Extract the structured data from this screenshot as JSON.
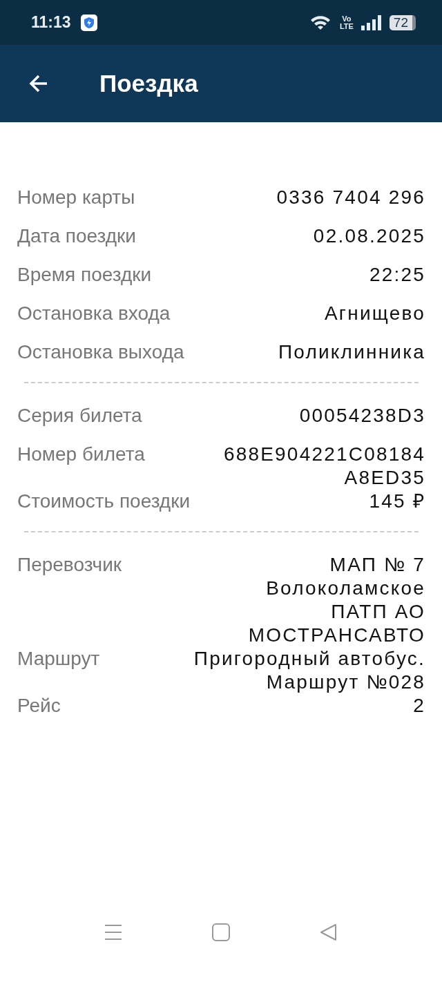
{
  "status_bar": {
    "time": "11:13",
    "network": "Vo\nLTE",
    "battery": "72"
  },
  "app_bar": {
    "title": "Поездка"
  },
  "sections": [
    {
      "rows": [
        {
          "label": "Номер карты",
          "value_lines": [
            "0336 7404 296"
          ]
        },
        {
          "label": "Дата поездки",
          "value_lines": [
            "02.08.2025"
          ]
        },
        {
          "label": "Время поездки",
          "value_lines": [
            "22:25"
          ]
        },
        {
          "label": "Остановка входа",
          "value_lines": [
            "Агнищево"
          ]
        },
        {
          "label": "Остановка выхода",
          "value_lines": [
            "Поликлинника"
          ]
        }
      ]
    },
    {
      "rows": [
        {
          "label": "Серия билета",
          "value_lines": [
            "00054238D3"
          ]
        },
        {
          "label": "Номер билета",
          "value_lines": [
            "688E904221C08184",
            "A8ED35"
          ]
        },
        {
          "label": "Стоимость поездки",
          "value_lines": [
            "145 ₽"
          ]
        }
      ]
    },
    {
      "rows": [
        {
          "label": "Перевозчик",
          "value_lines": [
            "МАП № 7",
            "Волоколамское",
            "ПАТП АО",
            "МОСТРАНСАВТО"
          ]
        },
        {
          "label": "Маршрут",
          "value_lines": [
            "Пригородный автобус.",
            "Маршрут №028"
          ]
        },
        {
          "label": "Рейс",
          "value_lines": [
            "2"
          ]
        }
      ]
    }
  ]
}
